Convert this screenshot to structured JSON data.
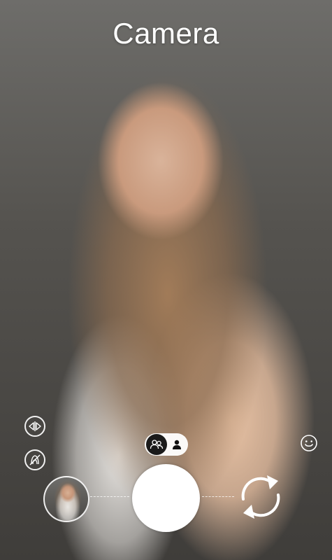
{
  "app": {
    "title": "Camera"
  },
  "controls": {
    "mirror_icon": "flip-horizontal-icon",
    "beauty_off_icon": "face-beauty-off-icon",
    "mode_group_icon": "group-people-icon",
    "mode_single_icon": "single-person-icon",
    "smile_icon": "smile-icon",
    "switch_camera_icon": "switch-camera-icon",
    "selected_mode": "group"
  },
  "colors": {
    "overlay_white": "#ffffff",
    "toggle_active_bg": "#1a1a1a"
  }
}
